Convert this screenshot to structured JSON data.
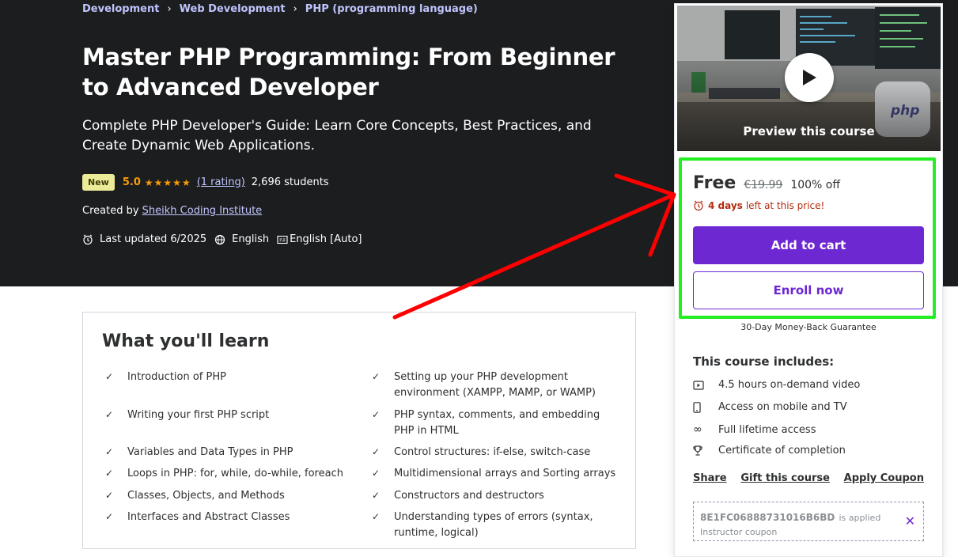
{
  "breadcrumb": {
    "items": [
      "Development",
      "Web Development",
      "PHP (programming language)"
    ]
  },
  "course": {
    "title": "Master PHP Programming: From Beginner to Advanced Developer",
    "subtitle": "Complete PHP Developer's Guide: Learn Core Concepts, Best Practices, and Create Dynamic Web Applications.",
    "badge": "New",
    "rating": "5.0",
    "rating_count": "(1 rating)",
    "students": "2,696 students",
    "created_by_label": "Created by",
    "instructor": "Sheikh Coding Institute",
    "last_updated": "Last updated 6/2025",
    "language": "English",
    "captions": "English [Auto]"
  },
  "learn": {
    "title": "What you'll learn",
    "items": [
      "Introduction of PHP",
      "Setting up your PHP development environment (XAMPP, MAMP, or WAMP)",
      "Writing your first PHP script",
      "PHP syntax, comments, and embedding PHP in HTML",
      "Variables and Data Types in PHP",
      "Control structures: if-else, switch-case",
      "Loops in PHP: for, while, do-while, foreach",
      "Multidimensional arrays and Sorting arrays",
      "Classes, Objects, and Methods",
      "Constructors and destructors",
      "Interfaces and Abstract Classes",
      "Understanding types of errors (syntax, runtime, logical)"
    ]
  },
  "sidebar": {
    "preview_label": "Preview this course",
    "price_now": "Free",
    "price_old": "€19.99",
    "price_off": "100% off",
    "timer_days": "4 days",
    "timer_text": "left at this price!",
    "add_to_cart": "Add to cart",
    "enroll_now": "Enroll now",
    "guarantee": "30-Day Money-Back Guarantee",
    "includes_title": "This course includes:",
    "includes": [
      "4.5 hours on-demand video",
      "Access on mobile and TV",
      "Full lifetime access",
      "Certificate of completion"
    ],
    "share": "Share",
    "gift": "Gift this course",
    "apply_coupon": "Apply Coupon",
    "coupon_code": "8E1FC06888731016B6BD",
    "coupon_applied": "is applied",
    "coupon_type": "Instructor coupon"
  },
  "colors": {
    "hero_bg": "#1c1d1f",
    "accent": "#6d28d2",
    "star": "#f69c08",
    "annotation_box": "#22ee22",
    "annotation_arrow": "#ff0000"
  },
  "icons": [
    "chevron-right-icon",
    "star-icon",
    "alarm-icon",
    "globe-icon",
    "captions-icon",
    "play-icon",
    "video-icon",
    "mobile-icon",
    "infinity-icon",
    "trophy-icon",
    "check-icon",
    "close-icon"
  ]
}
